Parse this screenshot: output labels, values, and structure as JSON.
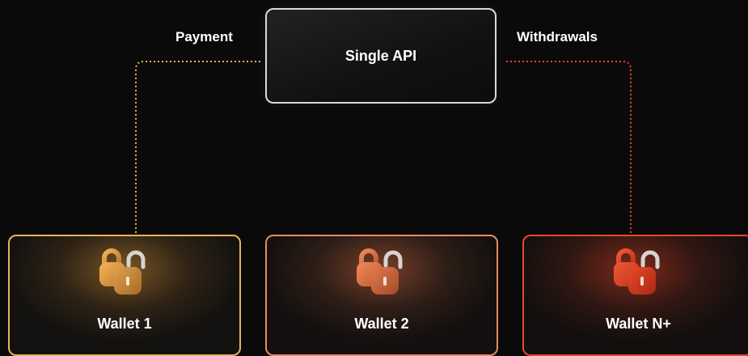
{
  "api": {
    "label": "Single API"
  },
  "flows": {
    "payment": "Payment",
    "withdrawals": "Withdrawals"
  },
  "colors": {
    "payment_line": "#e8b25a",
    "withdraw_line": "#e64a2a",
    "wallet_1": "#e8b25a",
    "wallet_2": "#e88a62",
    "wallet_3": "#e64a2a"
  },
  "wallets": [
    {
      "label": "Wallet 1",
      "icon": "padlock-icon"
    },
    {
      "label": "Wallet 2",
      "icon": "padlock-icon"
    },
    {
      "label": "Wallet N+",
      "icon": "padlock-icon"
    }
  ]
}
